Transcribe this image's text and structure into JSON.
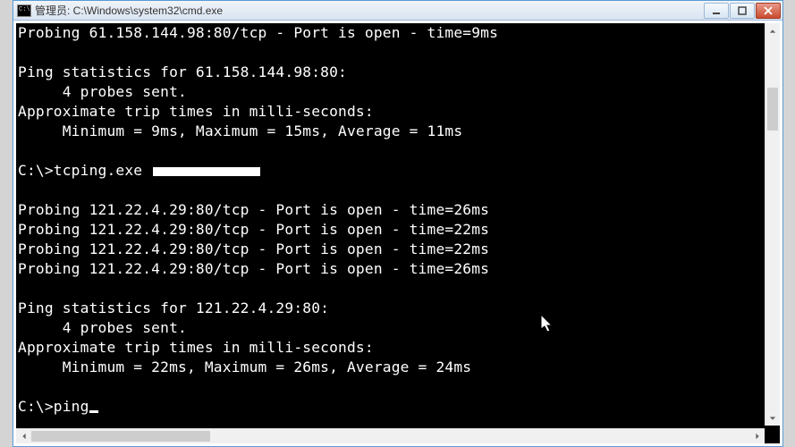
{
  "window": {
    "title": "管理员: C:\\Windows\\system32\\cmd.exe"
  },
  "terminal": {
    "lines": [
      "Probing 61.158.144.98:80/tcp - Port is open - time=9ms",
      "",
      "Ping statistics for 61.158.144.98:80:",
      "     4 probes sent.",
      "Approximate trip times in milli-seconds:",
      "     Minimum = 9ms, Maximum = 15ms, Average = 11ms",
      "",
      "C:\\>tcping.exe ",
      "",
      "Probing 121.22.4.29:80/tcp - Port is open - time=26ms",
      "Probing 121.22.4.29:80/tcp - Port is open - time=22ms",
      "Probing 121.22.4.29:80/tcp - Port is open - time=22ms",
      "Probing 121.22.4.29:80/tcp - Port is open - time=26ms",
      "",
      "Ping statistics for 121.22.4.29:80:",
      "     4 probes sent.",
      "Approximate trip times in milli-seconds:",
      "     Minimum = 22ms, Maximum = 26ms, Average = 24ms",
      "",
      "C:\\>ping"
    ],
    "redacted_line_index": 7,
    "cursor_line_index": 19
  }
}
